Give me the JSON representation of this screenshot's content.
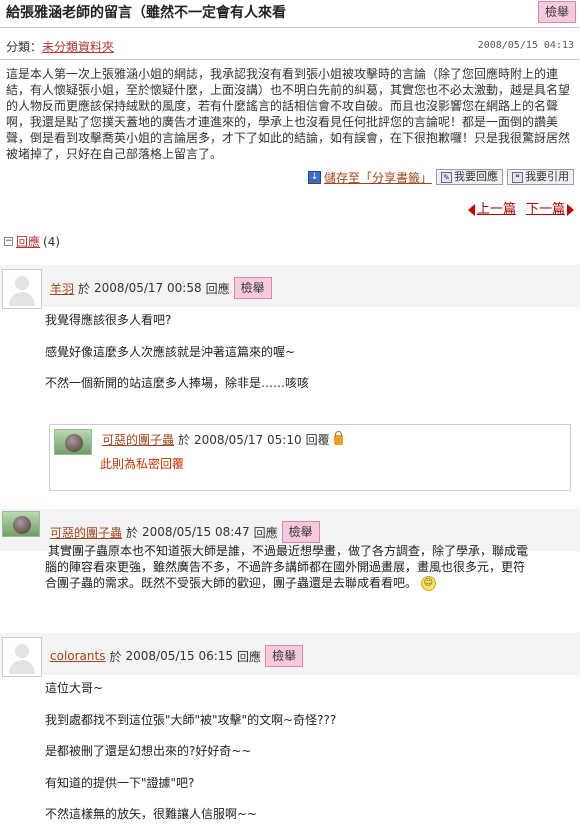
{
  "post": {
    "title": "給張雅涵老師的留言（雖然不一定會有人來看",
    "report_label": "檢舉",
    "category_label": "分類：",
    "category_name": "未分類資料夾",
    "date": "2008/05/15 04:13",
    "body": "這是本人第一次上張雅涵小姐的網誌，我承認我沒有看到張小姐被攻擊時的言論（除了您回應時附上的連結，有人懷疑張小姐，至於懷疑什麼，上面沒講）也不明白先前的糾葛，其實您也不必太激動，越是具名望的人物反而更應該保持絨默的風度，若有什麼謠言的話相信會不攻自破。而且也沒影響您在網路上的名聲啊，我還是點了您撲天蓋地的廣告才連進來的，學承上也沒看見任何批評您的言論呢！都是一面倒的讚美聲，倒是看到攻擊喬英小姐的言論居多，才下了如此的結論，如有誤會，在下很抱歉囉！只是我很驚訝居然被堵掉了，只好在自己部落格上留言了。"
  },
  "actions": {
    "save_label": "儲存至「分享書籤」",
    "reply_label": "我要回應",
    "cite_label": "我要引用"
  },
  "nav": {
    "prev_label": "上一篇",
    "next_label": "下一篇"
  },
  "replies": {
    "header_label": "回應",
    "count": "(4)"
  },
  "comments": [
    {
      "author": "羊羽",
      "prefix": "於",
      "date": "2008/05/17 00:58",
      "reply_label": "回應",
      "report_label": "檢舉",
      "lines": [
        "我覺得應該很多人看吧?",
        "感覺好像這麼多人次應該就是沖著這篇來的喔~",
        "不然一個新開的站這麼多人捧場，除非是……咳咳"
      ]
    },
    {
      "author": "可惡的團子蟲",
      "prefix": "於",
      "date": "2008/05/17 05:10",
      "reply_label": "回覆",
      "private_text": "此則為私密回覆"
    },
    {
      "author": "可惡的團子蟲",
      "prefix": "於",
      "date": "2008/05/15 08:47",
      "reply_label": "回應",
      "report_label": "檢舉",
      "lines": [
        "其實團子蟲原本也不知道張大師是誰，不過最近想學畫，做了各方調查，除了學承，聯成電",
        "腦的陣容看來更強，雖然廣告不多，不過許多講師都在國外開過畫展，畫風也很多元，更符",
        "合團子蟲的需求。既然不受張大師的歡迎，團子蟲還是去聯成看看吧。"
      ]
    },
    {
      "author": "colorants",
      "prefix": "於",
      "date": "2008/05/15 06:15",
      "reply_label": "回應",
      "report_label": "檢舉",
      "lines": [
        "這位大哥~",
        "我到處都找不到這位張\"大師\"被\"攻擊\"的文啊~奇怪???",
        "是都被刪了還是幻想出來的?好好奇~~",
        "有知道的提供一下\"證據\"吧?",
        "不然這樣無的放矢，很難讓人信服啊~~"
      ]
    }
  ]
}
